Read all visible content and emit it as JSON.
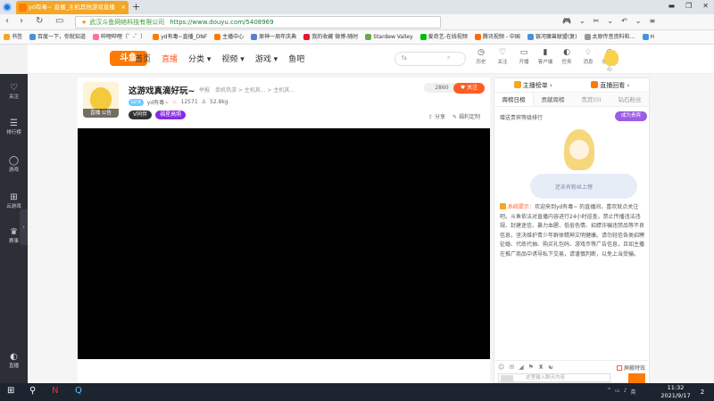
{
  "browser": {
    "tab_title": "yd有毒~ 直播_主机其他游戏直播",
    "tab_close": "×",
    "new_tab": "+",
    "site_name": "武汉斗鱼网络科技有限公司",
    "url": "https://www.douyu.com/5408969",
    "window_controls": [
      "▬",
      "❐",
      "✕"
    ],
    "nav_right": [
      "🎮",
      "⌄",
      "✂",
      "⌄",
      "↶",
      "⌄",
      "≡"
    ]
  },
  "bookmarks": [
    "书签",
    "百度一下，你就知道",
    "哔哩哔哩（゜-゜）",
    "yd有毒~直播_DNF",
    "主播中心",
    "原神一周年庆典",
    "我的收藏 微博-随时",
    "Stardew Valley",
    "爱奇艺-在线视频",
    "腾讯视频 - 中国",
    "银河魔兽联盟(复)",
    "太原传音资料和…",
    "H"
  ],
  "sidebar": [
    {
      "icon": "♡",
      "label": "关注"
    },
    {
      "icon": "☰",
      "label": "排行榜"
    },
    {
      "icon": "◯",
      "label": "游戏"
    },
    {
      "icon": "⊞",
      "label": "云游戏"
    },
    {
      "icon": "♛",
      "label": "赛事"
    },
    {
      "icon": "◐",
      "label": "直播"
    }
  ],
  "sidebar_toggle": "›",
  "header": {
    "logo": "斗鱼",
    "menu": [
      {
        "label": "首页",
        "active": false
      },
      {
        "label": "直播",
        "active": true
      },
      {
        "label": "分类 ▾",
        "active": false
      },
      {
        "label": "视频 ▾",
        "active": false
      },
      {
        "label": "游戏 ▾",
        "active": false
      },
      {
        "label": "鱼吧",
        "active": false
      }
    ],
    "search_placeholder": "fa",
    "search_icon": "⌕",
    "icons": [
      {
        "glyph": "◷",
        "label": "历史"
      },
      {
        "glyph": "♡",
        "label": "关注"
      },
      {
        "glyph": "▭",
        "label": "开播"
      },
      {
        "glyph": "▮",
        "label": "客户端"
      },
      {
        "glyph": "◐",
        "label": "任务"
      },
      {
        "glyph": "♢",
        "label": "消息"
      },
      {
        "glyph": "◎",
        "label": "创作中心"
      }
    ]
  },
  "room": {
    "announcement": "直播  公告",
    "title": "这游戏真滴好玩~",
    "category_prefix": "举报",
    "categories": "单机热游 > 主机其... > 主机其...",
    "level": "LV.4",
    "anchor_name": "yd有毒~",
    "hot_count": "12571",
    "fans": "52.8kg",
    "badge_vip": "V同伴",
    "badge_event": "福星高照",
    "hot_label": "2860",
    "follow_label": "♥ 关注",
    "share_label": "分享",
    "prize_label": "福利定制"
  },
  "right_panel": {
    "tabs_top": [
      "主播榜单 ›",
      "直播回看 ›"
    ],
    "tabs_sub": [
      "周榜日榜",
      "贡献周榜",
      "贵宾(0)",
      "钻石粉丝"
    ],
    "rank_tip": "赠送贵宾等级排行",
    "noble_button": "成为贵宾",
    "illust_caption": "还未有粉丝上榜",
    "system_tag": "系统提示：",
    "system_message": "欢迎来到yd有毒~ 的直播间，喜欢就点关注吧。斗鱼依法对直播内容进行24小时巡查，禁止传播违法违规、封建迷信、暴力血腥、低俗色情、招嫖诈骗违禁品等不良信息，坚决维护青少年群体精神文明健康。请勿轻信各类招聘征婚、代练代抽、购买礼包码、游戏币等广告信息，且如主播在推广商品中诱导私下交易，请谨慎判断，以免上当受骗。",
    "chat_icons": [
      "☺",
      "✉",
      "◢",
      "⚑",
      "♜",
      "☯"
    ],
    "block_effects": "屏蔽特效",
    "chat_placeholder": "这里输入聊天内容"
  },
  "taskbar": {
    "start": "⊞",
    "search": "⚲",
    "apps": [
      "N",
      "Q"
    ],
    "tray": [
      "^",
      "▭",
      "♪",
      "英"
    ],
    "time": "11:32",
    "date": "2021/9/17",
    "notif": "2"
  }
}
